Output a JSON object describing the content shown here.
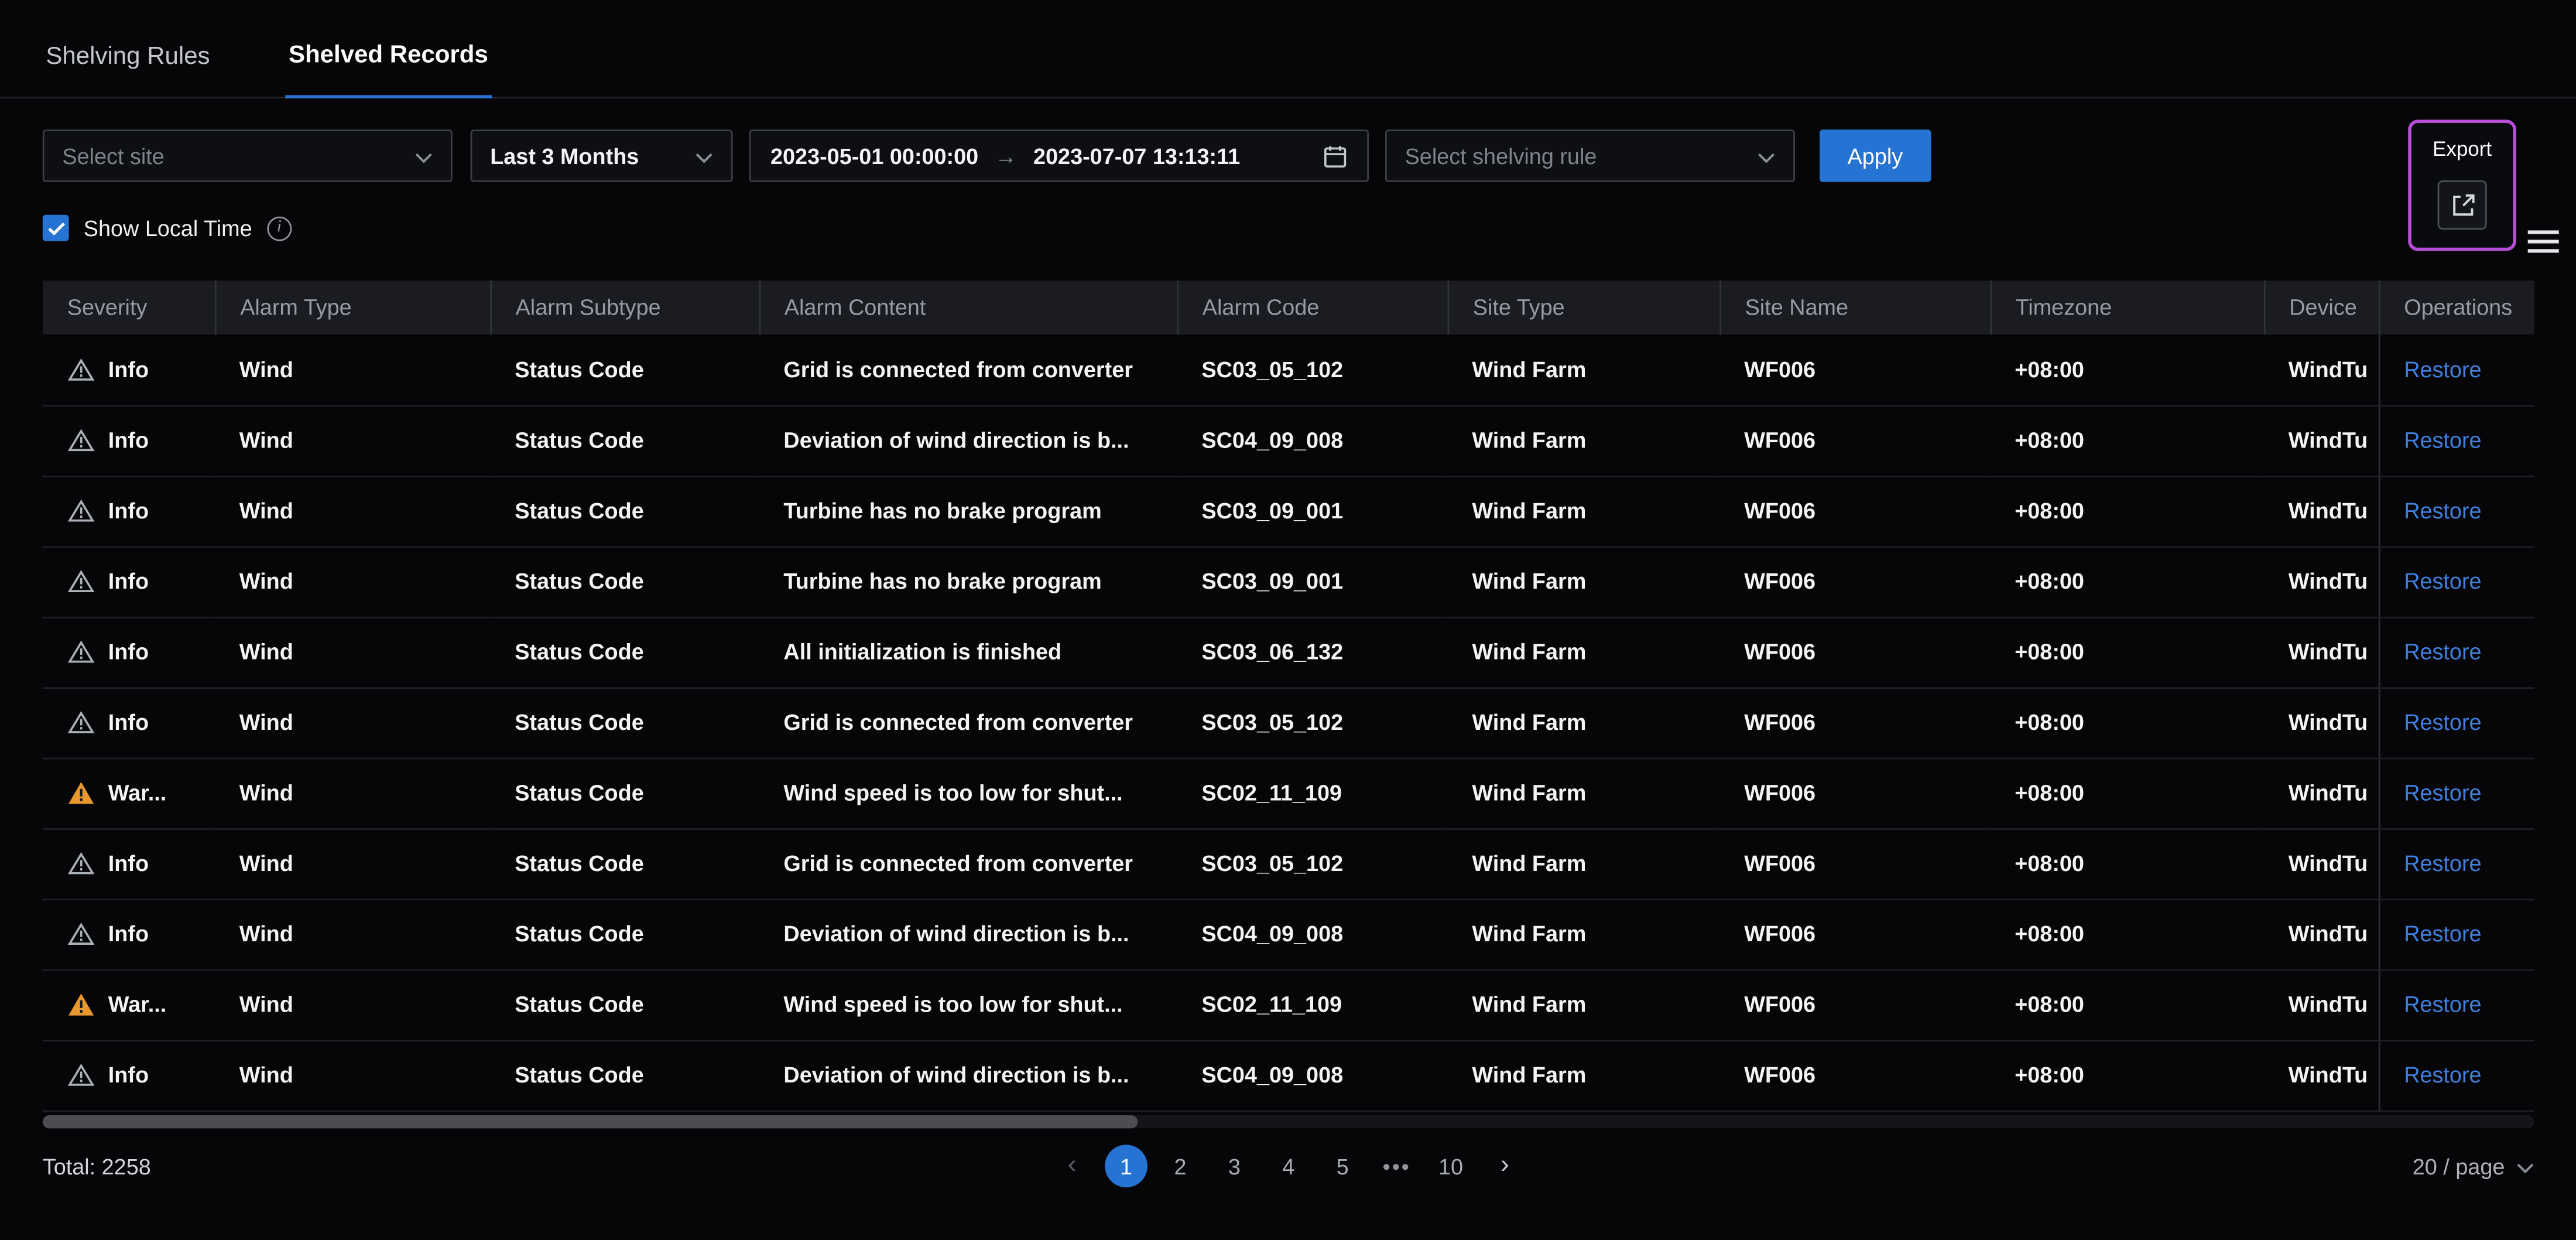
{
  "tabs": [
    {
      "label": "Shelving Rules"
    },
    {
      "label": "Shelved Records"
    }
  ],
  "active_tab": "Shelved Records",
  "filters": {
    "site_placeholder": "Select site",
    "time_range_value": "Last 3 Months",
    "date_start": "2023-05-01 00:00:00",
    "date_arrow": "→",
    "date_end": "2023-07-07 13:13:11",
    "rule_placeholder": "Select shelving rule",
    "apply_label": "Apply"
  },
  "toolbar": {
    "export_tooltip": "Export"
  },
  "show_local_time": {
    "label": "Show Local Time",
    "checked": true
  },
  "table": {
    "columns": [
      "Severity",
      "Alarm Type",
      "Alarm Subtype",
      "Alarm Content",
      "Alarm Code",
      "Site Type",
      "Site Name",
      "Timezone",
      "Device",
      "Operations"
    ],
    "rows": [
      {
        "severity": "info",
        "severity_label": "Info",
        "alarm_type": "Wind",
        "alarm_subtype": "Status Code",
        "alarm_content": "Grid is connected from converter",
        "alarm_code": "SC03_05_102",
        "site_type": "Wind Farm",
        "site_name": "WF006",
        "timezone": "+08:00",
        "device": "WindTu",
        "operation": "Restore"
      },
      {
        "severity": "info",
        "severity_label": "Info",
        "alarm_type": "Wind",
        "alarm_subtype": "Status Code",
        "alarm_content": "Deviation of wind direction is b...",
        "alarm_code": "SC04_09_008",
        "site_type": "Wind Farm",
        "site_name": "WF006",
        "timezone": "+08:00",
        "device": "WindTu",
        "operation": "Restore"
      },
      {
        "severity": "info",
        "severity_label": "Info",
        "alarm_type": "Wind",
        "alarm_subtype": "Status Code",
        "alarm_content": "Turbine has no brake program",
        "alarm_code": "SC03_09_001",
        "site_type": "Wind Farm",
        "site_name": "WF006",
        "timezone": "+08:00",
        "device": "WindTu",
        "operation": "Restore"
      },
      {
        "severity": "info",
        "severity_label": "Info",
        "alarm_type": "Wind",
        "alarm_subtype": "Status Code",
        "alarm_content": "Turbine has no brake program",
        "alarm_code": "SC03_09_001",
        "site_type": "Wind Farm",
        "site_name": "WF006",
        "timezone": "+08:00",
        "device": "WindTu",
        "operation": "Restore"
      },
      {
        "severity": "info",
        "severity_label": "Info",
        "alarm_type": "Wind",
        "alarm_subtype": "Status Code",
        "alarm_content": "All initialization is finished",
        "alarm_code": "SC03_06_132",
        "site_type": "Wind Farm",
        "site_name": "WF006",
        "timezone": "+08:00",
        "device": "WindTu",
        "operation": "Restore"
      },
      {
        "severity": "info",
        "severity_label": "Info",
        "alarm_type": "Wind",
        "alarm_subtype": "Status Code",
        "alarm_content": "Grid is connected from converter",
        "alarm_code": "SC03_05_102",
        "site_type": "Wind Farm",
        "site_name": "WF006",
        "timezone": "+08:00",
        "device": "WindTu",
        "operation": "Restore"
      },
      {
        "severity": "warning",
        "severity_label": "War...",
        "alarm_type": "Wind",
        "alarm_subtype": "Status Code",
        "alarm_content": "Wind speed is too low for shut...",
        "alarm_code": "SC02_11_109",
        "site_type": "Wind Farm",
        "site_name": "WF006",
        "timezone": "+08:00",
        "device": "WindTu",
        "operation": "Restore"
      },
      {
        "severity": "info",
        "severity_label": "Info",
        "alarm_type": "Wind",
        "alarm_subtype": "Status Code",
        "alarm_content": "Grid is connected from converter",
        "alarm_code": "SC03_05_102",
        "site_type": "Wind Farm",
        "site_name": "WF006",
        "timezone": "+08:00",
        "device": "WindTu",
        "operation": "Restore"
      },
      {
        "severity": "info",
        "severity_label": "Info",
        "alarm_type": "Wind",
        "alarm_subtype": "Status Code",
        "alarm_content": "Deviation of wind direction is b...",
        "alarm_code": "SC04_09_008",
        "site_type": "Wind Farm",
        "site_name": "WF006",
        "timezone": "+08:00",
        "device": "WindTu",
        "operation": "Restore"
      },
      {
        "severity": "warning",
        "severity_label": "War...",
        "alarm_type": "Wind",
        "alarm_subtype": "Status Code",
        "alarm_content": "Wind speed is too low for shut...",
        "alarm_code": "SC02_11_109",
        "site_type": "Wind Farm",
        "site_name": "WF006",
        "timezone": "+08:00",
        "device": "WindTu",
        "operation": "Restore"
      },
      {
        "severity": "info",
        "severity_label": "Info",
        "alarm_type": "Wind",
        "alarm_subtype": "Status Code",
        "alarm_content": "Deviation of wind direction is b...",
        "alarm_code": "SC04_09_008",
        "site_type": "Wind Farm",
        "site_name": "WF006",
        "timezone": "+08:00",
        "device": "WindTu",
        "operation": "Restore"
      }
    ]
  },
  "footer": {
    "total_label": "Total: 2258",
    "pagination": {
      "prev": "‹",
      "next": "›",
      "items": [
        "1",
        "2",
        "3",
        "4",
        "5",
        "•••",
        "10"
      ],
      "current": "1"
    },
    "page_size_label": "20 / page"
  },
  "colors": {
    "accent_blue": "#2574d4",
    "link_blue": "#3f80e0",
    "warning_orange": "#e8982c",
    "info_gray": "#aab0b8",
    "highlight_purple": "#b44fd6"
  }
}
